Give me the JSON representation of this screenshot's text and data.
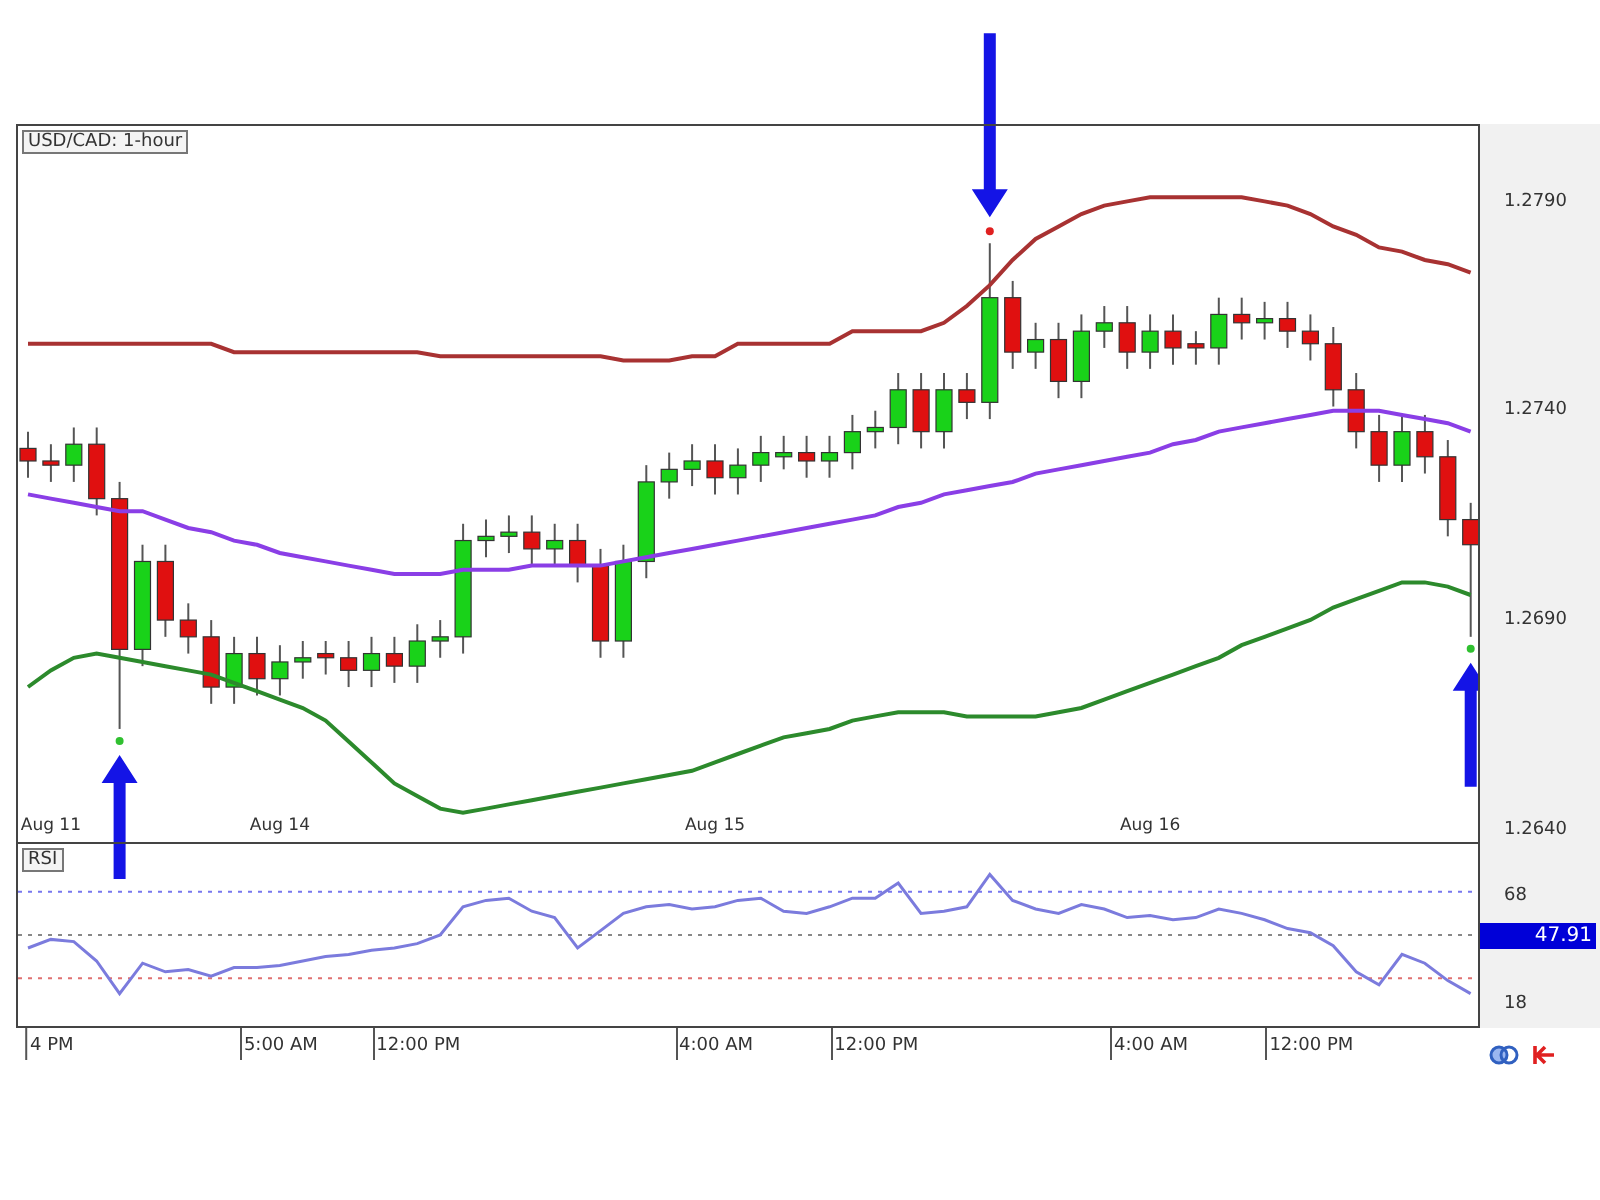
{
  "price_chart": {
    "chart_data": {
      "type": "candlestick",
      "title": "USD/CAD: 1-hour",
      "ylim": [
        1.2637,
        1.2808
      ],
      "yticks": [
        {
          "value": 1.279,
          "label": "1.2790"
        },
        {
          "value": 1.274,
          "label": "1.2740"
        },
        {
          "value": 1.269,
          "label": "1.2690"
        },
        {
          "value": 1.264,
          "label": "1.2640"
        }
      ],
      "categories": [
        null,
        "Aug 11",
        null,
        null,
        null,
        null,
        null,
        null,
        null,
        null,
        null,
        "Aug 14",
        null,
        null,
        null,
        null,
        null,
        null,
        null,
        null,
        null,
        null,
        null,
        null,
        null,
        null,
        null,
        null,
        null,
        null,
        "Aug 15",
        null,
        null,
        null,
        null,
        null,
        null,
        null,
        null,
        null,
        null,
        null,
        null,
        null,
        null,
        null,
        null,
        null,
        null,
        "Aug 16",
        null,
        null,
        null,
        null,
        null,
        null,
        null,
        null,
        null,
        null,
        null,
        null,
        null,
        null
      ],
      "ohlc": [
        [
          1.2731,
          1.2735,
          1.2724,
          1.2728
        ],
        [
          1.2728,
          1.2732,
          1.2723,
          1.2727
        ],
        [
          1.2727,
          1.2736,
          1.2723,
          1.2732
        ],
        [
          1.2732,
          1.2736,
          1.2715,
          1.2719
        ],
        [
          1.2719,
          1.2723,
          1.2664,
          1.2683
        ],
        [
          1.2683,
          1.2708,
          1.2679,
          1.2704
        ],
        [
          1.2704,
          1.2708,
          1.2686,
          1.269
        ],
        [
          1.269,
          1.2694,
          1.2682,
          1.2686
        ],
        [
          1.2686,
          1.269,
          1.267,
          1.2674
        ],
        [
          1.2674,
          1.2686,
          1.267,
          1.2682
        ],
        [
          1.2682,
          1.2686,
          1.2672,
          1.2676
        ],
        [
          1.2676,
          1.2684,
          1.2672,
          1.268
        ],
        [
          1.268,
          1.2685,
          1.2676,
          1.2681
        ],
        [
          1.2682,
          1.2685,
          1.2677,
          1.2681
        ],
        [
          1.2681,
          1.2685,
          1.2674,
          1.2678
        ],
        [
          1.2678,
          1.2686,
          1.2674,
          1.2682
        ],
        [
          1.2682,
          1.2686,
          1.2675,
          1.2679
        ],
        [
          1.2679,
          1.2689,
          1.2675,
          1.2685
        ],
        [
          1.2685,
          1.269,
          1.2681,
          1.2686
        ],
        [
          1.2686,
          1.2713,
          1.2682,
          1.2709
        ],
        [
          1.2709,
          1.2714,
          1.2705,
          1.271
        ],
        [
          1.271,
          1.2715,
          1.2706,
          1.2711
        ],
        [
          1.2711,
          1.2715,
          1.2703,
          1.2707
        ],
        [
          1.2707,
          1.2713,
          1.2703,
          1.2709
        ],
        [
          1.2709,
          1.2713,
          1.2699,
          1.2703
        ],
        [
          1.2703,
          1.2707,
          1.2681,
          1.2685
        ],
        [
          1.2685,
          1.2708,
          1.2681,
          1.2704
        ],
        [
          1.2704,
          1.2727,
          1.27,
          1.2723
        ],
        [
          1.2723,
          1.273,
          1.2719,
          1.2726
        ],
        [
          1.2726,
          1.2732,
          1.2722,
          1.2728
        ],
        [
          1.2728,
          1.2732,
          1.272,
          1.2724
        ],
        [
          1.2724,
          1.2731,
          1.272,
          1.2727
        ],
        [
          1.2727,
          1.2734,
          1.2723,
          1.273
        ],
        [
          1.2729,
          1.2734,
          1.2726,
          1.273
        ],
        [
          1.273,
          1.2734,
          1.2724,
          1.2728
        ],
        [
          1.2728,
          1.2734,
          1.2724,
          1.273
        ],
        [
          1.273,
          1.2739,
          1.2726,
          1.2735
        ],
        [
          1.2735,
          1.274,
          1.2731,
          1.2736
        ],
        [
          1.2736,
          1.2749,
          1.2732,
          1.2745
        ],
        [
          1.2745,
          1.2749,
          1.2731,
          1.2735
        ],
        [
          1.2735,
          1.2749,
          1.2731,
          1.2745
        ],
        [
          1.2745,
          1.2749,
          1.2738,
          1.2742
        ],
        [
          1.2742,
          1.278,
          1.2738,
          1.2767
        ],
        [
          1.2767,
          1.2771,
          1.275,
          1.2754
        ],
        [
          1.2754,
          1.2761,
          1.275,
          1.2757
        ],
        [
          1.2757,
          1.2761,
          1.2743,
          1.2747
        ],
        [
          1.2747,
          1.2763,
          1.2743,
          1.2759
        ],
        [
          1.2759,
          1.2765,
          1.2755,
          1.2761
        ],
        [
          1.2761,
          1.2765,
          1.275,
          1.2754
        ],
        [
          1.2754,
          1.2763,
          1.275,
          1.2759
        ],
        [
          1.2759,
          1.2763,
          1.2751,
          1.2755
        ],
        [
          1.2756,
          1.2759,
          1.2751,
          1.2755
        ],
        [
          1.2755,
          1.2767,
          1.2751,
          1.2763
        ],
        [
          1.2763,
          1.2767,
          1.2757,
          1.2761
        ],
        [
          1.2761,
          1.2766,
          1.2757,
          1.2762
        ],
        [
          1.2762,
          1.2766,
          1.2755,
          1.2759
        ],
        [
          1.2759,
          1.2763,
          1.2752,
          1.2756
        ],
        [
          1.2756,
          1.276,
          1.2741,
          1.2745
        ],
        [
          1.2745,
          1.2749,
          1.2731,
          1.2735
        ],
        [
          1.2735,
          1.2739,
          1.2723,
          1.2727
        ],
        [
          1.2727,
          1.2739,
          1.2723,
          1.2735
        ],
        [
          1.2735,
          1.2739,
          1.2725,
          1.2729
        ],
        [
          1.2729,
          1.2733,
          1.271,
          1.2714
        ],
        [
          1.2714,
          1.2718,
          1.2686,
          1.2708
        ]
      ],
      "series": [
        {
          "type": "line",
          "color": "#a83232",
          "values": [
            1.2756,
            1.2756,
            1.2756,
            1.2756,
            1.2756,
            1.2756,
            1.2756,
            1.2756,
            1.2756,
            1.2754,
            1.2754,
            1.2754,
            1.2754,
            1.2754,
            1.2754,
            1.2754,
            1.2754,
            1.2754,
            1.2753,
            1.2753,
            1.2753,
            1.2753,
            1.2753,
            1.2753,
            1.2753,
            1.2753,
            1.2752,
            1.2752,
            1.2752,
            1.2753,
            1.2753,
            1.2756,
            1.2756,
            1.2756,
            1.2756,
            1.2756,
            1.2759,
            1.2759,
            1.2759,
            1.2759,
            1.2761,
            1.2765,
            1.277,
            1.2776,
            1.2781,
            1.2784,
            1.2787,
            1.2789,
            1.279,
            1.2791,
            1.2791,
            1.2791,
            1.2791,
            1.2791,
            1.279,
            1.2789,
            1.2787,
            1.2784,
            1.2782,
            1.2779,
            1.2778,
            1.2776,
            1.2775,
            1.2773
          ]
        },
        {
          "type": "line",
          "color": "#8a3ee6",
          "values": [
            1.272,
            1.2719,
            1.2718,
            1.2717,
            1.2716,
            1.2716,
            1.2714,
            1.2712,
            1.2711,
            1.2709,
            1.2708,
            1.2706,
            1.2705,
            1.2704,
            1.2703,
            1.2702,
            1.2701,
            1.2701,
            1.2701,
            1.2702,
            1.2702,
            1.2702,
            1.2703,
            1.2703,
            1.2703,
            1.2703,
            1.2704,
            1.2705,
            1.2706,
            1.2707,
            1.2708,
            1.2709,
            1.271,
            1.2711,
            1.2712,
            1.2713,
            1.2714,
            1.2715,
            1.2717,
            1.2718,
            1.272,
            1.2721,
            1.2722,
            1.2723,
            1.2725,
            1.2726,
            1.2727,
            1.2728,
            1.2729,
            1.273,
            1.2732,
            1.2733,
            1.2735,
            1.2736,
            1.2737,
            1.2738,
            1.2739,
            1.274,
            1.274,
            1.274,
            1.2739,
            1.2738,
            1.2737,
            1.2735
          ]
        },
        {
          "type": "line",
          "color": "#2c8a2c",
          "values": [
            1.2674,
            1.2678,
            1.2681,
            1.2682,
            1.2681,
            1.268,
            1.2679,
            1.2678,
            1.2677,
            1.2675,
            1.2673,
            1.2671,
            1.2669,
            1.2666,
            1.2661,
            1.2656,
            1.2651,
            1.2648,
            1.2645,
            1.2644,
            1.2645,
            1.2646,
            1.2647,
            1.2648,
            1.2649,
            1.265,
            1.2651,
            1.2652,
            1.2653,
            1.2654,
            1.2656,
            1.2658,
            1.266,
            1.2662,
            1.2663,
            1.2664,
            1.2666,
            1.2667,
            1.2668,
            1.2668,
            1.2668,
            1.2667,
            1.2667,
            1.2667,
            1.2667,
            1.2668,
            1.2669,
            1.2671,
            1.2673,
            1.2675,
            1.2677,
            1.2679,
            1.2681,
            1.2684,
            1.2686,
            1.2688,
            1.269,
            1.2693,
            1.2695,
            1.2697,
            1.2699,
            1.2699,
            1.2698,
            1.2696
          ]
        }
      ]
    },
    "signal_markers": true
  },
  "rsi_panel": {
    "current_value": "47.91",
    "chart_data": {
      "type": "line",
      "title": "RSI",
      "ylim": [
        8,
        92
      ],
      "yticks": [
        68,
        18
      ],
      "categories": [
        null,
        "4 PM",
        null,
        null,
        null,
        null,
        null,
        null,
        null,
        null,
        null,
        "5:00 AM",
        null,
        null,
        null,
        null,
        null,
        "12:00 PM",
        null,
        null,
        null,
        null,
        null,
        null,
        null,
        null,
        null,
        null,
        null,
        null,
        "4:00 AM",
        null,
        null,
        null,
        null,
        null,
        null,
        "12:00 PM",
        null,
        null,
        null,
        null,
        null,
        null,
        null,
        null,
        null,
        null,
        null,
        "4:00 AM",
        null,
        null,
        null,
        null,
        null,
        null,
        "12:00 PM",
        null,
        null,
        null,
        null,
        null,
        null,
        null
      ],
      "series": [
        {
          "color": "#7b7bdd",
          "values": [
            44,
            48,
            47,
            38,
            23,
            37,
            33,
            34,
            31,
            35,
            35,
            36,
            38,
            40,
            41,
            43,
            44,
            46,
            50,
            63,
            66,
            67,
            61,
            58,
            44,
            52,
            60,
            63,
            64,
            62,
            63,
            66,
            67,
            61,
            60,
            63,
            67,
            67,
            74,
            60,
            61,
            63,
            78,
            66,
            62,
            60,
            64,
            62,
            58,
            59,
            57,
            58,
            62,
            60,
            57,
            53,
            51,
            45,
            33,
            27,
            41,
            37,
            29,
            23
          ]
        }
      ],
      "ref_lines": [
        {
          "axis": "y",
          "value": 70,
          "color": "#7777ee"
        },
        {
          "axis": "y",
          "value": 50,
          "color": "#888888"
        },
        {
          "axis": "y",
          "value": 30,
          "color": "#e07070"
        }
      ]
    }
  }
}
